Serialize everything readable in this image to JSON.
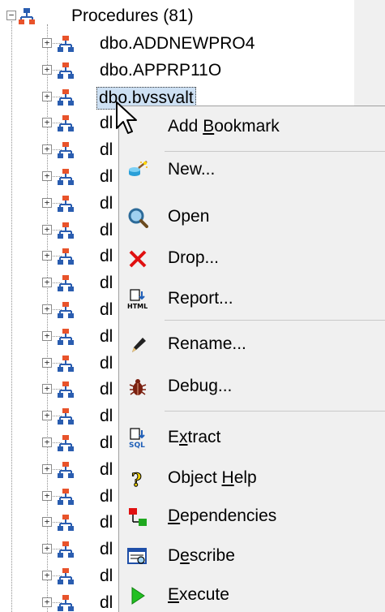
{
  "tree": {
    "root": {
      "label": "Procedures (81)"
    },
    "items": [
      {
        "label": "dbo.ADDNEWPRO4"
      },
      {
        "label": "dbo.APPRP11O"
      },
      {
        "label": "dbo.bvssvalt"
      },
      {
        "label": "dl"
      },
      {
        "label": "dl"
      },
      {
        "label": "dl"
      },
      {
        "label": "dl"
      },
      {
        "label": "dl"
      },
      {
        "label": "dl"
      },
      {
        "label": "dl"
      },
      {
        "label": "dl"
      },
      {
        "label": "dl"
      },
      {
        "label": "dl"
      },
      {
        "label": "dl"
      },
      {
        "label": "dl"
      },
      {
        "label": "dl"
      },
      {
        "label": "dl"
      },
      {
        "label": "dl"
      },
      {
        "label": "dl"
      },
      {
        "label": "dl"
      },
      {
        "label": "dl"
      },
      {
        "label": "dl"
      }
    ]
  },
  "context_menu": {
    "items": [
      {
        "label_pre": "Add ",
        "mnemonic": "B",
        "label_post": "ookmark",
        "icon": "none"
      },
      {
        "label_pre": "New...",
        "mnemonic": "",
        "label_post": "",
        "icon": "new-object-icon"
      },
      {
        "label_pre": "Open",
        "mnemonic": "",
        "label_post": "",
        "icon": "magnifier-icon"
      },
      {
        "label_pre": "Drop...",
        "mnemonic": "",
        "label_post": "",
        "icon": "red-x-icon"
      },
      {
        "label_pre": "Report...",
        "mnemonic": "",
        "label_post": "",
        "icon": "html-report-icon"
      },
      {
        "label_pre": "Rename...",
        "mnemonic": "",
        "label_post": "",
        "icon": "pencil-icon"
      },
      {
        "label_pre": "Debug...",
        "mnemonic": "",
        "label_post": "",
        "icon": "bug-icon"
      },
      {
        "label_pre": "E",
        "mnemonic": "x",
        "label_post": "tract",
        "icon": "sql-extract-icon"
      },
      {
        "label_pre": "Object ",
        "mnemonic": "H",
        "label_post": "elp",
        "icon": "question-icon"
      },
      {
        "label_pre": "",
        "mnemonic": "D",
        "label_post": "ependencies",
        "icon": "dependencies-icon"
      },
      {
        "label_pre": "D",
        "mnemonic": "e",
        "label_post": "scribe",
        "icon": "describe-icon"
      },
      {
        "label_pre": "",
        "mnemonic": "E",
        "label_post": "xecute",
        "icon": "play-icon"
      }
    ]
  },
  "colors": {
    "selection": "#cde0f3",
    "menu_bg": "#f0f0f0",
    "proc_icon_red": "#e8532b",
    "proc_icon_blue": "#2a5db0"
  }
}
